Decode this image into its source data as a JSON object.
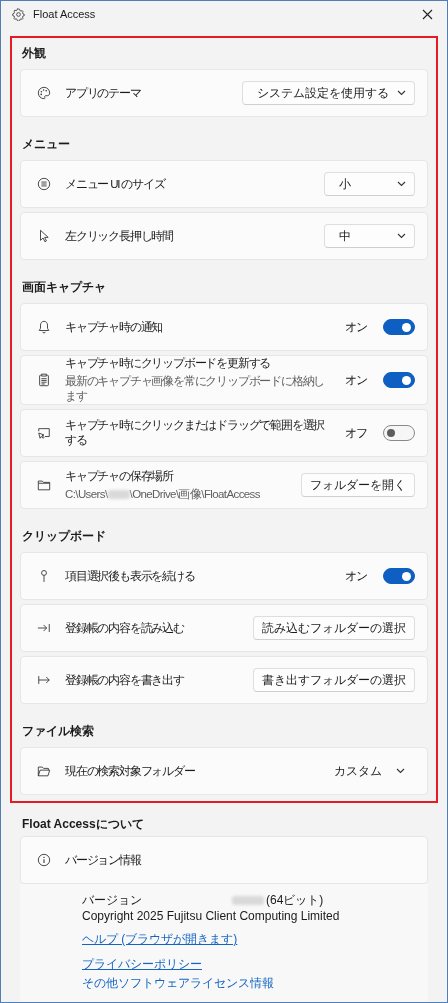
{
  "window": {
    "title": "Float Access"
  },
  "sections": [
    {
      "heading": "外観",
      "rows": [
        {
          "kind": "dropdown",
          "label": "アプリのテーマ",
          "value": "システム設定を使用する"
        }
      ]
    },
    {
      "heading": "メニュー",
      "rows": [
        {
          "kind": "dropdown",
          "label": "メニュー UI のサイズ",
          "value": "小"
        },
        {
          "kind": "dropdown",
          "label": "左クリック長押し時間",
          "value": "中"
        }
      ]
    },
    {
      "heading": "画面キャプチャ",
      "rows": [
        {
          "kind": "toggle",
          "label": "キャプチャ時の通知",
          "on": true,
          "state_label": "オン"
        },
        {
          "kind": "toggle",
          "label": "キャプチャ時にクリップボードを更新する",
          "description": "最新のキャプチャ画像を常にクリップボードに格納します",
          "on": true,
          "state_label": "オン"
        },
        {
          "kind": "toggle",
          "label": "キャプチャ時にクリックまたはドラッグで範囲を選択する",
          "on": false,
          "state_label": "オフ"
        },
        {
          "kind": "button",
          "label": "キャプチャの保存場所",
          "path_start": "C:\\Users\\",
          "path_end": "\\OneDrive\\画像\\FloatAccess",
          "button": "フォルダーを開く"
        }
      ]
    },
    {
      "heading": "クリップボード",
      "rows": [
        {
          "kind": "toggle",
          "label": "項目選択後も表示を続ける",
          "on": true,
          "state_label": "オン"
        },
        {
          "kind": "button",
          "label": "登録帳の内容を読み込む",
          "button": "読み込むフォルダーの選択"
        },
        {
          "kind": "button",
          "label": "登録帳の内容を書き出す",
          "button": "書き出すフォルダーの選択"
        }
      ]
    },
    {
      "heading": "ファイル検索",
      "rows": [
        {
          "kind": "dropdown",
          "label": "現在の検索対象フォルダー",
          "value": "カスタム"
        }
      ]
    }
  ],
  "about": {
    "heading": "Float Accessについて",
    "card_label": "バージョン情報",
    "version_label": "バージョン",
    "version_suffix": "(64ビット)",
    "copyright": "Copyright 2025 Fujitsu Client Computing Limited",
    "link_groups": [
      [
        "ヘルプ (ブラウザが開きます)"
      ],
      [
        "プライバシーポリシー",
        "その他ソフトウェアライセンス情報"
      ]
    ]
  }
}
